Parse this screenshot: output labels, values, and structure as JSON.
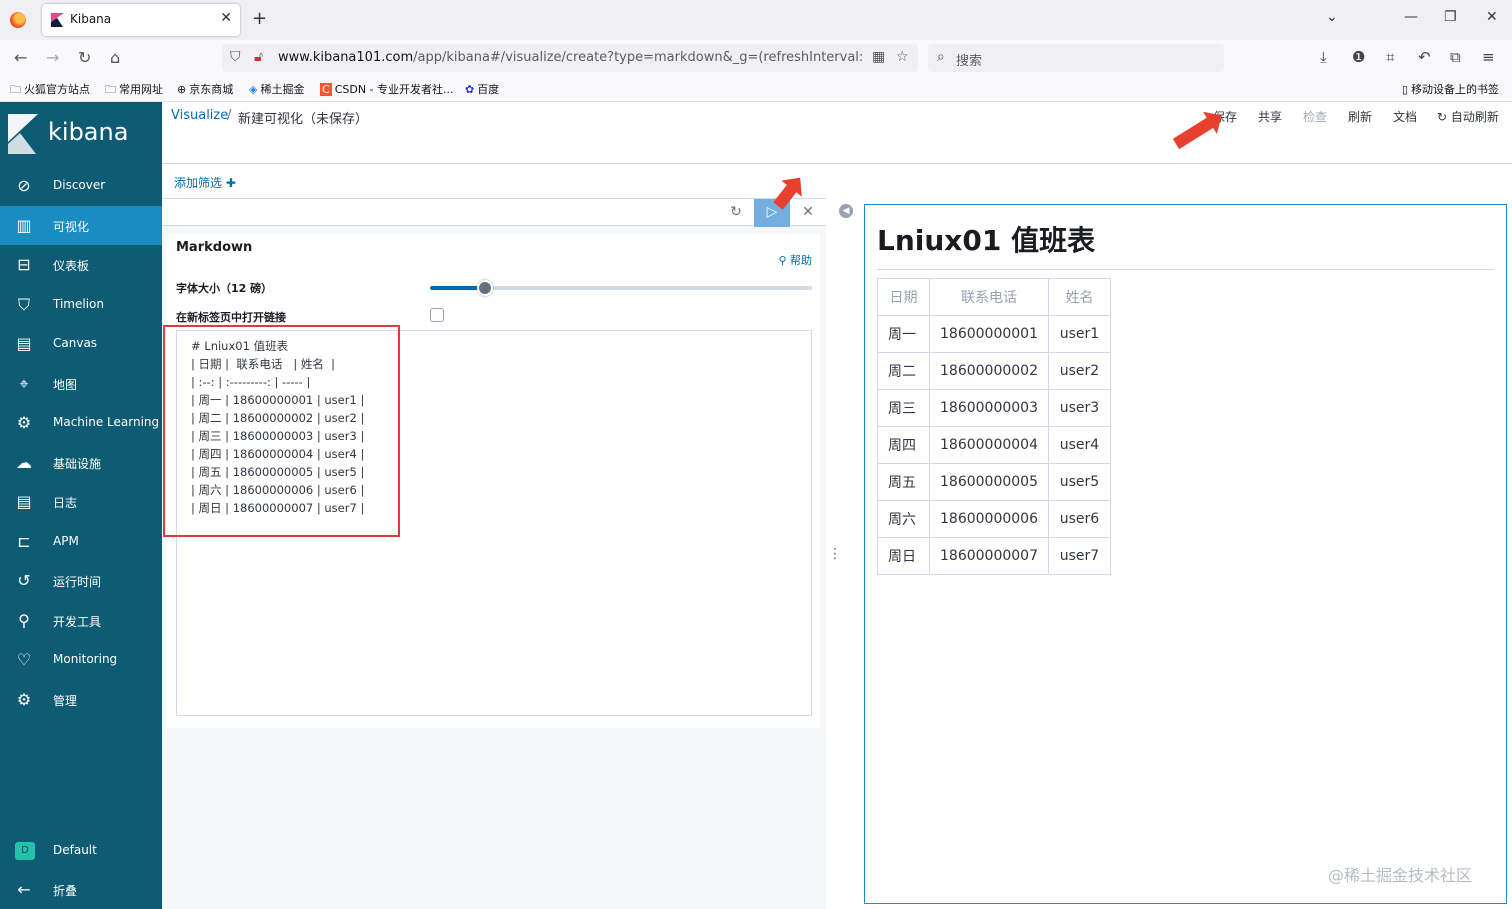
{
  "browser": {
    "tab_title": "Kibana",
    "url_host": "www.kibana101.com",
    "url_path": "/app/kibana#/visualize/create?type=markdown&_g=(refreshInterval:(pause:!t,",
    "search_placeholder": "搜索",
    "bookmarks": [
      "火狐官方站点",
      "常用网址",
      "京东商城",
      "稀土掘金",
      "CSDN - 专业开发者社...",
      "百度"
    ],
    "mobile_bookmarks": "移动设备上的书签"
  },
  "kibana": {
    "logo_text": "kibana",
    "nav": [
      {
        "label": "Discover",
        "icon": "compass-icon"
      },
      {
        "label": "可视化",
        "icon": "visualize-icon"
      },
      {
        "label": "仪表板",
        "icon": "dashboard-icon"
      },
      {
        "label": "Timelion",
        "icon": "timelion-icon"
      },
      {
        "label": "Canvas",
        "icon": "canvas-icon"
      },
      {
        "label": "地图",
        "icon": "map-icon"
      },
      {
        "label": "Machine Learning",
        "icon": "ml-icon"
      },
      {
        "label": "基础设施",
        "icon": "infra-icon"
      },
      {
        "label": "日志",
        "icon": "logs-icon"
      },
      {
        "label": "APM",
        "icon": "apm-icon"
      },
      {
        "label": "运行时间",
        "icon": "uptime-icon"
      },
      {
        "label": "开发工具",
        "icon": "devtools-icon"
      },
      {
        "label": "Monitoring",
        "icon": "monitoring-icon"
      },
      {
        "label": "管理",
        "icon": "gear-icon"
      }
    ],
    "space_initial": "D",
    "space_label": "Default",
    "collapse_label": "折叠"
  },
  "header": {
    "breadcrumb_root": "Visualize",
    "breadcrumb_sep": "/",
    "breadcrumb_current": "新建可视化（未保存）",
    "menu": {
      "save": "保存",
      "share": "共享",
      "inspect": "检查",
      "refresh": "刷新",
      "docs": "文档",
      "auto_refresh": "自动刷新"
    }
  },
  "filter": {
    "add_filter": "添加筛选"
  },
  "editor": {
    "panel_title": "Markdown",
    "help": "帮助",
    "font_size_label": "字体大小（12 磅）",
    "font_size_value": 12,
    "new_tab_label": "在新标签页中打开链接",
    "markdown_lines": [
      "# Lniux01 值班表",
      "| 日期 |  联系电话   | 姓名  |",
      "| :--: | :---------: | ----- |",
      "| 周一 | 18600000001 | user1 |",
      "| 周二 | 18600000002 | user2 |",
      "| 周三 | 18600000003 | user3 |",
      "| 周四 | 18600000004 | user4 |",
      "| 周五 | 18600000005 | user5 |",
      "| 周六 | 18600000006 | user6 |",
      "| 周日 | 18600000007 | user7 |"
    ]
  },
  "preview": {
    "title": "Lniux01 值班表",
    "headers": [
      "日期",
      "联系电话",
      "姓名"
    ],
    "rows": [
      [
        "周一",
        "18600000001",
        "user1"
      ],
      [
        "周二",
        "18600000002",
        "user2"
      ],
      [
        "周三",
        "18600000003",
        "user3"
      ],
      [
        "周四",
        "18600000004",
        "user4"
      ],
      [
        "周五",
        "18600000005",
        "user5"
      ],
      [
        "周六",
        "18600000006",
        "user6"
      ],
      [
        "周日",
        "18600000007",
        "user7"
      ]
    ]
  },
  "watermark": "@稀土掘金技术社区",
  "colors": {
    "sidebar": "#0f5b73",
    "active_nav": "#1a8cc0",
    "link": "#006bb4",
    "annotation_red": "#e03b3b"
  }
}
